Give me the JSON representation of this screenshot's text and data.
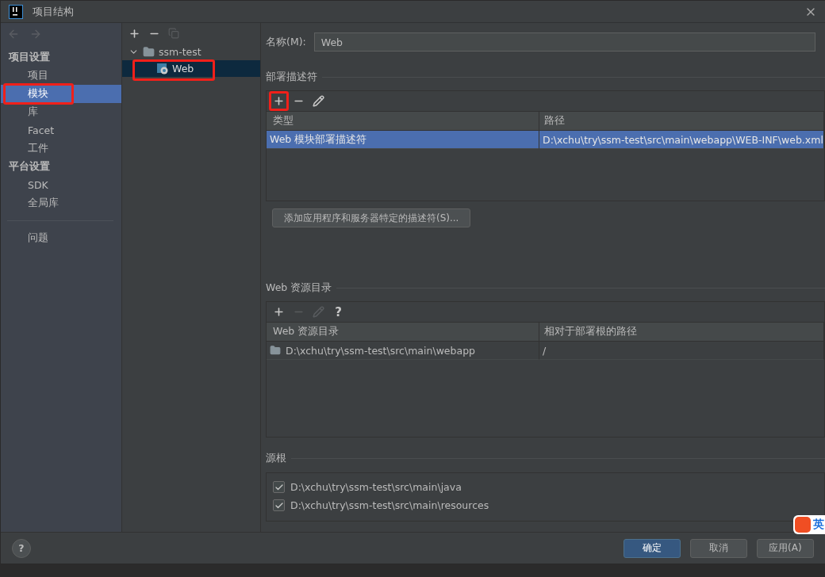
{
  "window": {
    "title": "项目结构"
  },
  "sidebar": {
    "sections": [
      {
        "heading": "项目设置",
        "items": [
          {
            "label": "项目",
            "selected": false,
            "annotated": false
          },
          {
            "label": "模块",
            "selected": true,
            "annotated": true
          },
          {
            "label": "库",
            "selected": false,
            "annotated": false
          },
          {
            "label": "Facet",
            "selected": false,
            "annotated": false
          },
          {
            "label": "工件",
            "selected": false,
            "annotated": false
          }
        ]
      },
      {
        "heading": "平台设置",
        "items": [
          {
            "label": "SDK",
            "selected": false,
            "annotated": false
          },
          {
            "label": "全局库",
            "selected": false,
            "annotated": false
          }
        ]
      }
    ],
    "extra_items": [
      {
        "label": "问题",
        "selected": false,
        "annotated": false
      }
    ]
  },
  "tree": {
    "nodes": [
      {
        "label": "ssm-test",
        "kind": "folder",
        "expanded": true,
        "selected": false,
        "annotated": false,
        "children": [
          {
            "label": "Web",
            "kind": "web",
            "selected": true,
            "annotated": true
          }
        ]
      }
    ]
  },
  "facet": {
    "name_label": "名称(M):",
    "name_value": "Web",
    "deployment": {
      "title": "部署描述符",
      "toolbar": [
        {
          "kind": "add",
          "disabled": false,
          "annotated": true
        },
        {
          "kind": "remove",
          "disabled": false,
          "annotated": false
        },
        {
          "kind": "edit",
          "disabled": false,
          "annotated": false
        }
      ],
      "columns": [
        "类型",
        "路径"
      ],
      "rows": [
        {
          "cells": [
            "Web 模块部署描述符",
            "D:\\xchu\\try\\ssm-test\\src\\main\\webapp\\WEB-INF\\web.xml"
          ],
          "selected": true
        }
      ],
      "add_button": "添加应用程序和服务器特定的描述符(S)..."
    },
    "web_resources": {
      "title": "Web 资源目录",
      "toolbar": [
        {
          "kind": "add",
          "disabled": false,
          "annotated": false
        },
        {
          "kind": "remove",
          "disabled": true,
          "annotated": false
        },
        {
          "kind": "edit",
          "disabled": true,
          "annotated": false
        },
        {
          "kind": "help",
          "label": "?",
          "disabled": false,
          "annotated": false
        }
      ],
      "columns": [
        "Web 资源目录",
        "相对于部署根的路径"
      ],
      "rows": [
        {
          "cells": [
            "D:\\xchu\\try\\ssm-test\\src\\main\\webapp",
            "/"
          ],
          "selected": false
        }
      ]
    },
    "source_roots": {
      "title": "源根",
      "items": [
        {
          "path": "D:\\xchu\\try\\ssm-test\\src\\main\\java",
          "checked": true
        },
        {
          "path": "D:\\xchu\\try\\ssm-test\\src\\main\\resources",
          "checked": true
        }
      ]
    }
  },
  "footer": {
    "help": "?",
    "buttons": [
      {
        "label": "确定",
        "primary": true
      },
      {
        "label": "取消",
        "primary": false
      },
      {
        "label": "应用(A)",
        "primary": false
      }
    ]
  },
  "ime_indicator": {
    "label": "英"
  }
}
